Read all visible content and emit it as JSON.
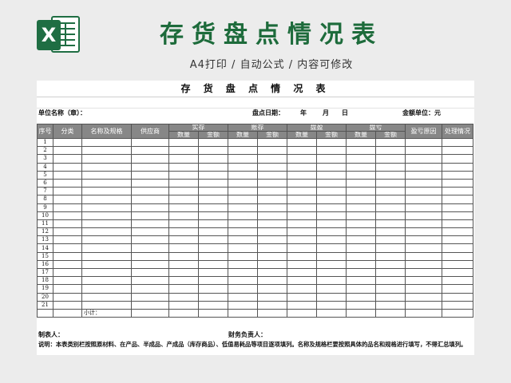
{
  "banner": {
    "icon_letter": "X",
    "title": "存货盘点情况表",
    "subtitle": "A4打印 / 自动公式 / 内容可修改"
  },
  "sheet": {
    "title": "存 货 盘 点 情 况 表",
    "unit_label": "单位名称（章）：",
    "date_label": "盘点日期：",
    "year": "年",
    "month": "月",
    "day": "日",
    "amount_unit_label": "金额单位：元",
    "headers": {
      "seq": "序号",
      "category": "分类",
      "name": "名称及规格",
      "supplier": "供应商",
      "actual": "实存",
      "book": "账存",
      "surplus": "盘盈",
      "deficit": "盘亏",
      "reason": "盈亏原因",
      "handling": "处理情况",
      "qty": "数量",
      "amount": "金额"
    },
    "rows": [
      "1",
      "2",
      "3",
      "4",
      "5",
      "6",
      "7",
      "8",
      "9",
      "10",
      "11",
      "12",
      "13",
      "14",
      "15",
      "16",
      "17",
      "18",
      "19",
      "20",
      "21"
    ],
    "subtotal_label": "小计：",
    "preparer_label": "制表人：",
    "finance_label": "财务负责人：",
    "note": "说明：本表类别栏按照原材料、在产品、半成品、产成品（库存商品）、低值易耗品等项目逐项填列。名称及规格栏要按照具体的品名和规格进行填写，不得汇总填列。"
  }
}
